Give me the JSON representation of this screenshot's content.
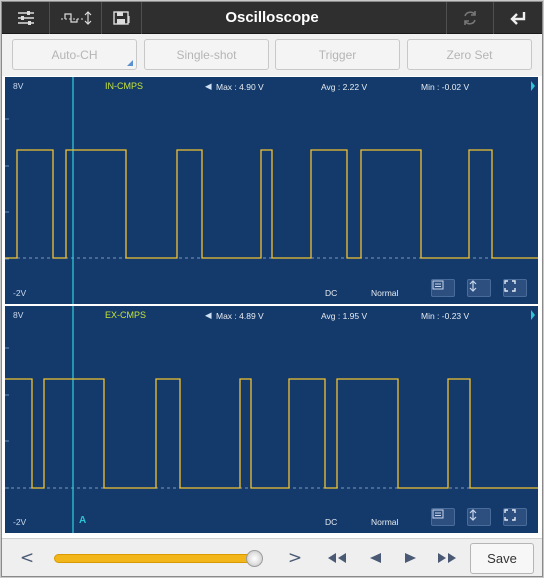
{
  "app": {
    "title": "Oscilloscope"
  },
  "toolbar_buttons": [
    {
      "label": "Auto-CH"
    },
    {
      "label": "Single-shot"
    },
    {
      "label": "Trigger"
    },
    {
      "label": "Zero Set"
    }
  ],
  "channels": [
    {
      "name": "IN-CMPS",
      "max": "Max : 4.90 V",
      "avg": "Avg : 2.22 V",
      "min": "Min : -0.02 V",
      "scale_top": "8V",
      "scale_bottom": "-2V",
      "coupling": "DC",
      "mode": "Normal",
      "waveform": [
        [
          0,
          0
        ],
        [
          12,
          0
        ],
        [
          12,
          1
        ],
        [
          48,
          1
        ],
        [
          48,
          0
        ],
        [
          61,
          0
        ],
        [
          61,
          1
        ],
        [
          121,
          1
        ],
        [
          121,
          0
        ],
        [
          172,
          0
        ],
        [
          172,
          1
        ],
        [
          197,
          1
        ],
        [
          197,
          0
        ],
        [
          256,
          0
        ],
        [
          256,
          1
        ],
        [
          267,
          1
        ],
        [
          267,
          0
        ],
        [
          306,
          0
        ],
        [
          306,
          1
        ],
        [
          342,
          1
        ],
        [
          342,
          0
        ],
        [
          356,
          0
        ],
        [
          356,
          1
        ],
        [
          416,
          1
        ],
        [
          416,
          0
        ],
        [
          464,
          0
        ],
        [
          464,
          1
        ],
        [
          487,
          1
        ],
        [
          487,
          0
        ],
        [
          533,
          0
        ]
      ]
    },
    {
      "name": "EX-CMPS",
      "max": "Max : 4.89 V",
      "avg": "Avg : 1.95 V",
      "min": "Min : -0.23 V",
      "scale_top": "8V",
      "scale_bottom": "-2V",
      "coupling": "DC",
      "mode": "Normal",
      "waveform": [
        [
          0,
          1
        ],
        [
          27,
          1
        ],
        [
          27,
          0
        ],
        [
          39,
          0
        ],
        [
          39,
          1
        ],
        [
          99,
          1
        ],
        [
          99,
          0
        ],
        [
          151,
          0
        ],
        [
          151,
          1
        ],
        [
          175,
          1
        ],
        [
          175,
          0
        ],
        [
          235,
          0
        ],
        [
          235,
          1
        ],
        [
          246,
          1
        ],
        [
          246,
          0
        ],
        [
          284,
          0
        ],
        [
          284,
          1
        ],
        [
          320,
          1
        ],
        [
          320,
          0
        ],
        [
          332,
          0
        ],
        [
          332,
          1
        ],
        [
          393,
          1
        ],
        [
          393,
          0
        ],
        [
          443,
          0
        ],
        [
          443,
          1
        ],
        [
          465,
          1
        ],
        [
          465,
          0
        ],
        [
          533,
          0
        ]
      ]
    }
  ],
  "cursor_label": "A",
  "bottom_bar": {
    "prev_label": "<",
    "next_label": ">",
    "slider_position": 0.96,
    "save_label": "Save"
  },
  "colors": {
    "panel_bg": "#133a6a",
    "signal": "#f1c232",
    "cursor": "#2ec4d6",
    "accent_green": "#c6e23b"
  }
}
